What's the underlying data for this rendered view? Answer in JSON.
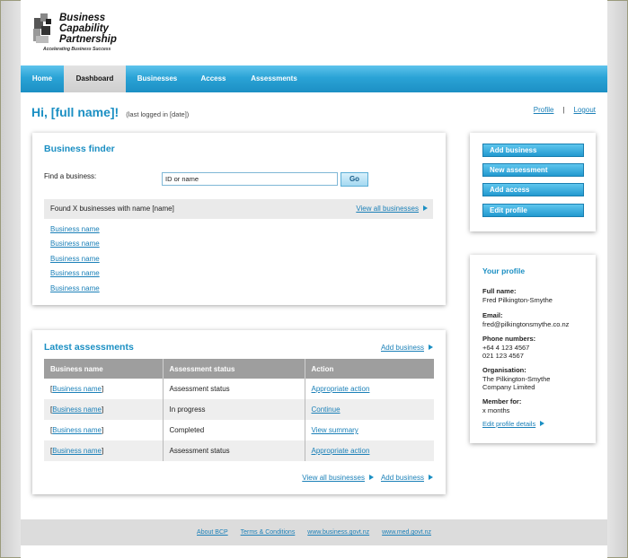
{
  "logo": {
    "line1": "Business",
    "line2": "Capability",
    "line3": "Partnership",
    "tagline": "Accelerating Business Success"
  },
  "nav": {
    "items": [
      {
        "label": "Home"
      },
      {
        "label": "Dashboard"
      },
      {
        "label": "Businesses"
      },
      {
        "label": "Access"
      },
      {
        "label": "Assessments"
      }
    ]
  },
  "greeting": {
    "title": "Hi, [full name]!",
    "last_logged": "(last logged in [date])"
  },
  "top_links": {
    "profile": "Profile",
    "separator": "|",
    "logout": "Logout"
  },
  "finder": {
    "title": "Business finder",
    "find_label": "Find a business:",
    "input_value": "ID or name",
    "go_label": "Go",
    "found_text": "Found X businesses with name [name]",
    "view_all": "View all businesses",
    "results": [
      "Business name",
      "Business name",
      "Business name",
      "Business name",
      "Business name"
    ]
  },
  "latest": {
    "title": "Latest assessments",
    "add_business": "Add business",
    "columns": [
      "Business name",
      "Assessment status",
      "Action"
    ],
    "rows": [
      {
        "name": "Business name",
        "status": "Assessment status",
        "action": "Appropriate action"
      },
      {
        "name": "Business name",
        "status": "In progress",
        "action": "Continue"
      },
      {
        "name": "Business name",
        "status": "Completed",
        "action": "View summary"
      },
      {
        "name": "Business name",
        "status": "Assessment status",
        "action": "Appropriate action"
      }
    ],
    "view_all": "View all businesses",
    "add_business_footer": "Add business"
  },
  "actions": {
    "add_business": "Add business",
    "new_assessment": "New assessment",
    "add_access": "Add access",
    "edit_profile": "Edit profile"
  },
  "profile": {
    "title": "Your profile",
    "full_name_label": "Full name:",
    "full_name": "Fred Pilkington-Smythe",
    "email_label": "Email:",
    "email": "fred@pilkingtonsmythe.co.nz",
    "phone_label": "Phone numbers:",
    "phone1": "+64 4 123 4567",
    "phone2": "021 123 4567",
    "org_label": "Organisation:",
    "org_line1": "The Pilkington-Smythe",
    "org_line2": "Company Limited",
    "member_label": "Member for:",
    "member_value": "x months",
    "edit_link": "Edit profile details"
  },
  "footer": {
    "links": [
      "About BCP",
      "Terms & Conditions",
      "www.business.govt.nz",
      "www.med.govt.nz"
    ]
  },
  "colors": {
    "accent": "#1b8fc3",
    "nav_top": "#5ec3ec",
    "nav_bottom": "#1c8fc4",
    "link": "#1b80b8"
  }
}
